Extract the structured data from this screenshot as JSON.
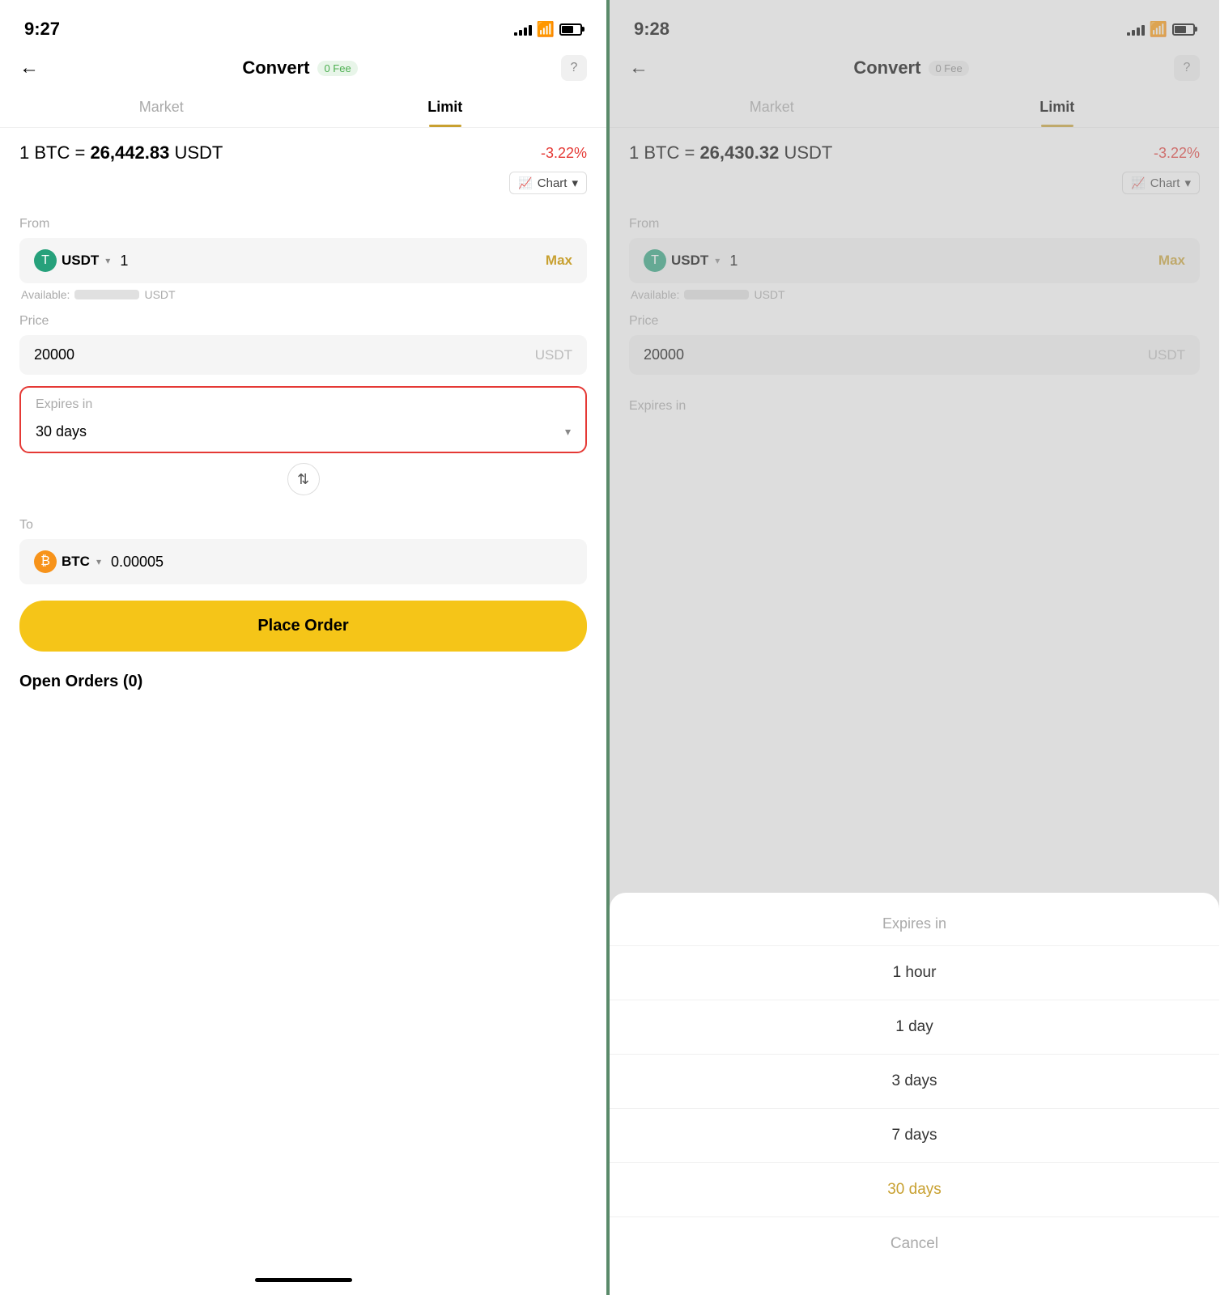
{
  "left": {
    "status": {
      "time": "9:27",
      "signal": [
        2,
        3,
        4,
        5
      ],
      "wifi": "wifi",
      "battery": "battery"
    },
    "header": {
      "back": "←",
      "title": "Convert",
      "fee": "0 Fee",
      "help": "?"
    },
    "tabs": [
      {
        "label": "Market",
        "active": false
      },
      {
        "label": "Limit",
        "active": true
      }
    ],
    "price": {
      "prefix": "1 BTC =",
      "value": "26,442.83",
      "suffix": "USDT",
      "change": "-3.22%"
    },
    "chart_label": "Chart",
    "from": {
      "label": "From",
      "currency": "USDT",
      "icon_type": "usdt",
      "value": "1",
      "max": "Max",
      "available_label": "Available:",
      "available_suffix": "USDT"
    },
    "price_field": {
      "label": "Price",
      "value": "20000",
      "unit": "USDT"
    },
    "expires": {
      "label": "Expires in",
      "value": "30 days"
    },
    "to": {
      "label": "To",
      "currency": "BTC",
      "icon_type": "btc",
      "value": "0.00005"
    },
    "place_order": "Place Order",
    "open_orders": "Open Orders (0)"
  },
  "right": {
    "status": {
      "time": "9:28"
    },
    "header": {
      "back": "←",
      "title": "Convert",
      "fee": "0 Fee",
      "help": "?"
    },
    "tabs": [
      {
        "label": "Market",
        "active": false
      },
      {
        "label": "Limit",
        "active": true
      }
    ],
    "price": {
      "prefix": "1 BTC =",
      "value": "26,430.32",
      "suffix": "USDT",
      "change": "-3.22%"
    },
    "chart_label": "Chart",
    "from": {
      "label": "From",
      "currency": "USDT",
      "icon_type": "usdt",
      "value": "1",
      "max": "Max",
      "available_label": "Available:",
      "available_suffix": "USDT"
    },
    "price_field": {
      "label": "Price",
      "value": "20000",
      "unit": "USDT"
    },
    "expires_label": "Expires in",
    "bottom_sheet": {
      "header": "Expires in",
      "items": [
        {
          "label": "1 hour",
          "selected": false
        },
        {
          "label": "1 day",
          "selected": false
        },
        {
          "label": "3 days",
          "selected": false
        },
        {
          "label": "7 days",
          "selected": false
        },
        {
          "label": "30 days",
          "selected": true
        },
        {
          "label": "Cancel",
          "is_cancel": true
        }
      ]
    }
  }
}
